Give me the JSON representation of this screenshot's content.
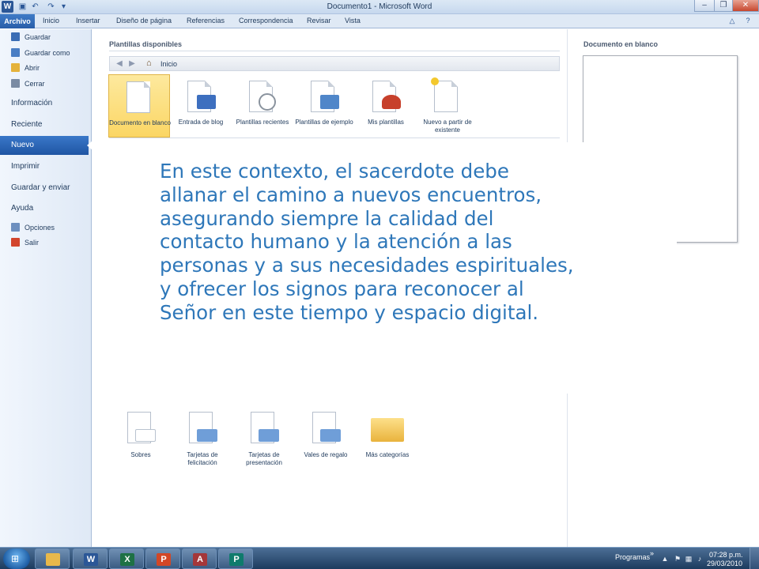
{
  "window": {
    "title": "Documento1 - Microsoft Word",
    "app_icon_letter": "W",
    "qat": [
      "save-icon",
      "undo-icon",
      "redo-icon",
      "customize-icon"
    ],
    "controls": {
      "minimize": "‒",
      "restore": "❐",
      "close": "✕"
    }
  },
  "ribbon": {
    "file_tab": "Archivo",
    "tabs": [
      "Inicio",
      "Insertar",
      "Diseño de página",
      "Referencias",
      "Correspondencia",
      "Revisar",
      "Vista"
    ]
  },
  "backstage": {
    "commands_top": [
      {
        "label": "Guardar",
        "icon": "save-icon",
        "color": "#3b6db5"
      },
      {
        "label": "Guardar como",
        "icon": "save-as-icon",
        "color": "#4a7ec4"
      },
      {
        "label": "Abrir",
        "icon": "open-folder-icon",
        "color": "#e4b23b"
      },
      {
        "label": "Cerrar",
        "icon": "close-doc-icon",
        "color": "#7a8ba3"
      }
    ],
    "tabs": [
      "Información",
      "Reciente",
      "Nuevo",
      "Imprimir",
      "Guardar y enviar",
      "Ayuda"
    ],
    "selected_tab": "Nuevo",
    "commands_bottom": [
      {
        "label": "Opciones",
        "icon": "options-icon",
        "color": "#6d8fbf"
      },
      {
        "label": "Salir",
        "icon": "exit-icon",
        "color": "#d2452d"
      }
    ]
  },
  "templates": {
    "section_title": "Plantillas disponibles",
    "breadcrumb": "Inicio",
    "row1": [
      {
        "label": "Documento en blanco",
        "icon": "blank-document-icon",
        "accent": "",
        "selected": true
      },
      {
        "label": "Entrada de blog",
        "icon": "blog-post-icon",
        "accent": "#3d6fbf",
        "selected": false
      },
      {
        "label": "Plantillas recientes",
        "icon": "recent-templates-icon",
        "accent": "#8a939e",
        "selected": false
      },
      {
        "label": "Plantillas de ejemplo",
        "icon": "sample-templates-icon",
        "accent": "#4f86c9",
        "selected": false
      },
      {
        "label": "Mis plantillas",
        "icon": "my-templates-icon",
        "accent": "#c7402b",
        "selected": false
      },
      {
        "label": "Nuevo a partir de existente",
        "icon": "new-from-existing-icon",
        "accent": "#f3c82e",
        "selected": false
      }
    ],
    "row2": [
      {
        "label": "Sobres",
        "icon": "envelope-icon",
        "accent": "#b9c3cf"
      },
      {
        "label": "Tarjetas de felicitación",
        "icon": "greeting-card-icon",
        "accent": "#6f9ed8"
      },
      {
        "label": "Tarjetas de presentación",
        "icon": "business-card-icon",
        "accent": "#6f9ed8"
      },
      {
        "label": "Vales de regalo",
        "icon": "gift-voucher-icon",
        "accent": "#6f9ed8"
      },
      {
        "label": "Más categorías",
        "icon": "folder-icon",
        "accent": "#e9b33d"
      }
    ]
  },
  "preview": {
    "title": "Documento en blanco"
  },
  "overlay": {
    "lines": [
      "En este contexto, el sacerdote debe",
      "allanar el camino a nuevos encuentros,",
      "asegurando siempre la calidad del",
      "contacto humano y la atención a las",
      "personas y a sus necesidades espirituales,",
      "y ofrecer los signos para reconocer al",
      "Señor en este tiempo y espacio digital."
    ]
  },
  "taskbar": {
    "apps": [
      {
        "name": "explorer",
        "letter": "",
        "color": "#e8b84a"
      },
      {
        "name": "word",
        "letter": "W",
        "color": "#2b5797"
      },
      {
        "name": "excel",
        "letter": "X",
        "color": "#1e7145"
      },
      {
        "name": "powerpoint",
        "letter": "P",
        "color": "#d24726"
      },
      {
        "name": "access",
        "letter": "A",
        "color": "#a4373a"
      },
      {
        "name": "publisher",
        "letter": "P",
        "color": "#0f7b6c"
      }
    ],
    "toolbar_label": "Programas",
    "time": "07:28 p.m.",
    "date": "29/03/2010"
  }
}
